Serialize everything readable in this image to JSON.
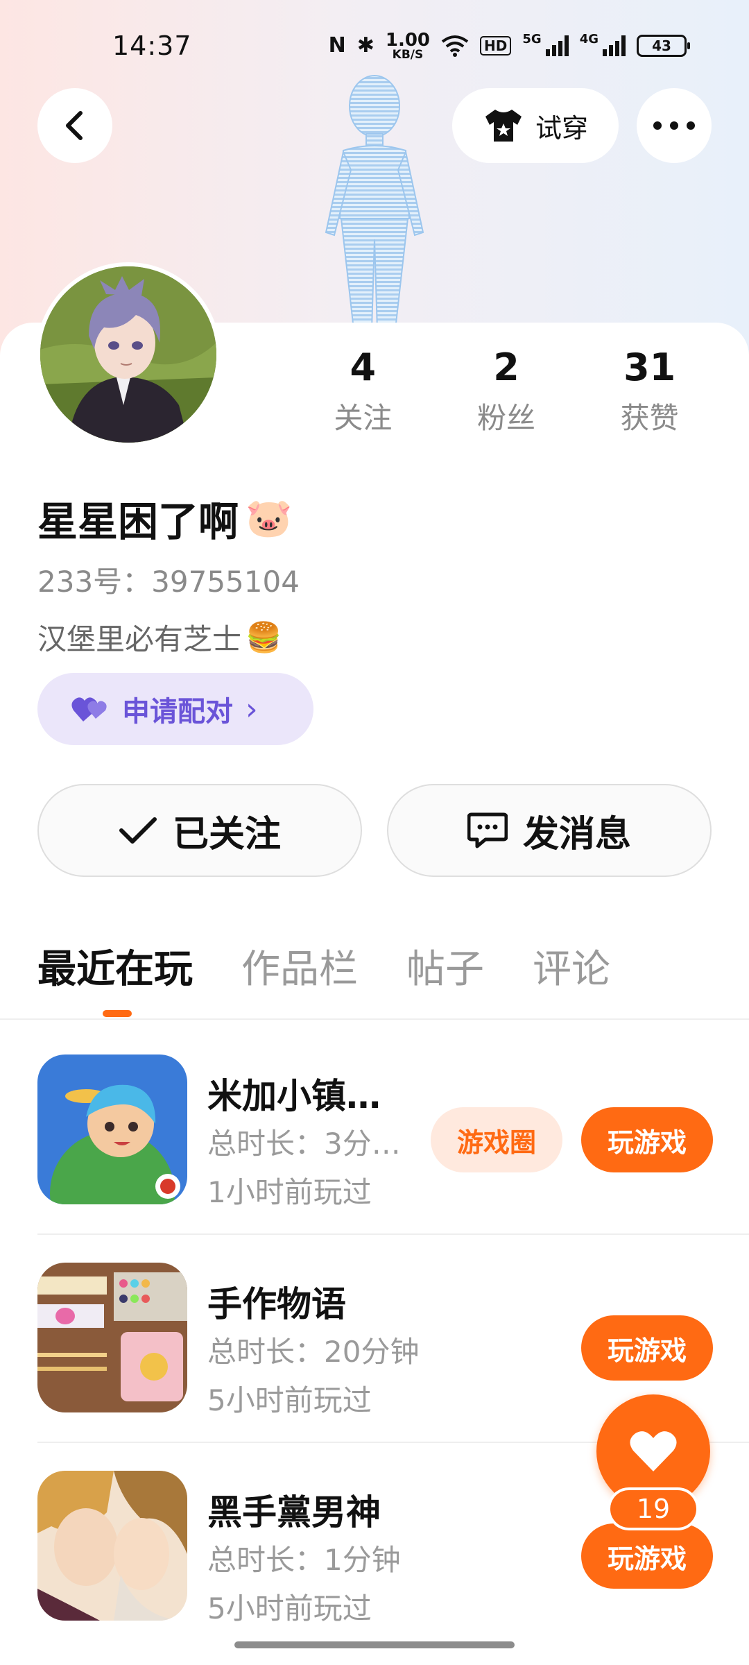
{
  "status_bar": {
    "time": "14:37",
    "nfc": "N",
    "bluetooth": "✱",
    "net_speed_value": "1.00",
    "net_speed_unit": "KB/S",
    "hd": "HD",
    "network1": "5G",
    "network2": "4G",
    "battery": "43"
  },
  "header": {
    "try_on_label": "试穿",
    "icons": {
      "back": "chevron-left-icon",
      "try_on": "tshirt-icon",
      "more": "more-dots-icon"
    }
  },
  "profile": {
    "nickname": "星星困了啊",
    "nickname_emoji": "🐷",
    "id_text": "233号：39755104",
    "bio": "汉堡里必有芝士",
    "bio_emoji": "🍔",
    "pair_label": "申请配对",
    "pair_arrow": "›",
    "stats": [
      {
        "value": "4",
        "label": "关注"
      },
      {
        "value": "2",
        "label": "粉丝"
      },
      {
        "value": "31",
        "label": "获赞"
      }
    ]
  },
  "actions": {
    "followed_label": "已关注",
    "message_label": "发消息"
  },
  "tabs": [
    {
      "label": "最近在玩",
      "active": true
    },
    {
      "label": "作品栏",
      "active": false
    },
    {
      "label": "帖子",
      "active": false
    },
    {
      "label": "评论",
      "active": false
    }
  ],
  "games": [
    {
      "name": "米加小镇…",
      "duration": "总时长：3分…",
      "last_played": "1小时前玩过",
      "circle_label": "游戏圈",
      "play_label": "玩游戏"
    },
    {
      "name": "手作物语",
      "duration": "总时长：20分钟",
      "last_played": "5小时前玩过",
      "play_label": "玩游戏"
    },
    {
      "name": "黑手黨男神",
      "duration": "总时长：1分钟",
      "last_played": "5小时前玩过",
      "play_label": "玩游戏"
    }
  ],
  "like_fab": {
    "count": "19"
  },
  "colors": {
    "accent": "#ff6a13",
    "pair_purple": "#6a54d8",
    "pair_bg": "#ebe6fa",
    "muted": "#9a9a9a"
  }
}
